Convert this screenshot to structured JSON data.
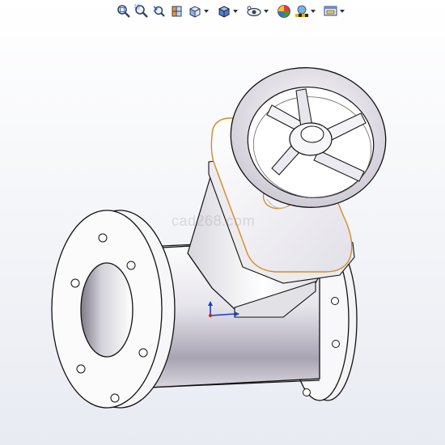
{
  "toolbar": {
    "buttons": [
      {
        "name": "zoom-to-fit-icon",
        "has_dropdown": false
      },
      {
        "name": "zoom-to-area-icon",
        "has_dropdown": false
      },
      {
        "name": "previous-view-icon",
        "has_dropdown": false
      },
      {
        "name": "section-view-icon",
        "has_dropdown": false
      },
      {
        "name": "view-orientation-icon",
        "has_dropdown": true
      },
      {
        "name": "display-style-icon",
        "has_dropdown": true
      },
      {
        "name": "hide-show-items-icon",
        "has_dropdown": true
      },
      {
        "name": "edit-appearance-icon",
        "has_dropdown": false
      },
      {
        "name": "apply-scene-icon",
        "has_dropdown": true
      },
      {
        "name": "view-settings-icon",
        "has_dropdown": true
      }
    ]
  },
  "watermark": "cad268.com",
  "colors": {
    "selection_highlight": "#d8892a",
    "triad_x": "#1a3ccf",
    "triad_y": "#1a3ccf",
    "model_body": "#f4f4f6",
    "model_edge": "#111111"
  }
}
